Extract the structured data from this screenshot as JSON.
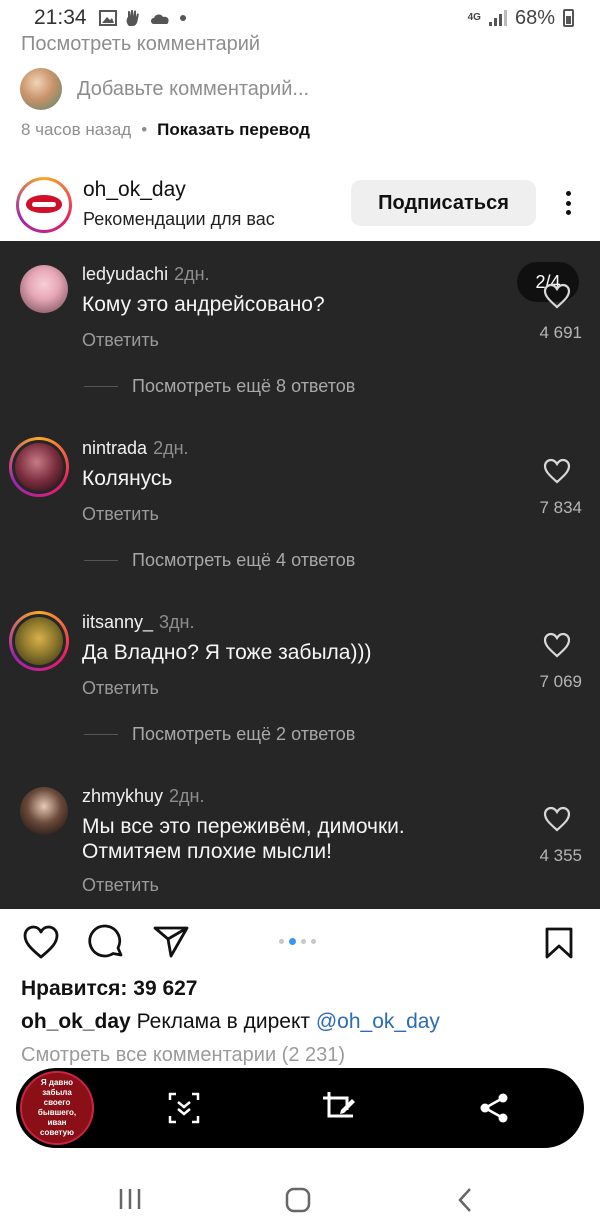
{
  "status_bar": {
    "time": "21:34",
    "network": "4G",
    "battery": "68%",
    "icons": [
      "image-icon",
      "hand-icon",
      "cloud-icon",
      "dot-icon"
    ]
  },
  "top": {
    "view_comment": "Посмотреть комментарий",
    "add_comment_placeholder": "Добавьте комментарий...",
    "time_ago": "8 часов назад",
    "separator": "•",
    "show_translation": "Показать перевод"
  },
  "post": {
    "username": "oh_ok_day",
    "subtitle": "Рекомендации для вас",
    "follow_label": "Подписаться"
  },
  "carousel": {
    "counter": "2/4",
    "comments": [
      {
        "username": "ledyudachi",
        "time": "2дн.",
        "text": "Кому это андрейсовано?",
        "reply": "Ответить",
        "likes": "4 691",
        "more": "Посмотреть ещё 8 ответов"
      },
      {
        "username": "nintrada",
        "time": "2дн.",
        "text": "Колянусь",
        "reply": "Ответить",
        "likes": "7 834",
        "more": "Посмотреть ещё 4 ответов"
      },
      {
        "username": "iitsanny_",
        "time": "3дн.",
        "text": "Да Владно? Я тоже забыла)))",
        "reply": "Ответить",
        "likes": "7 069",
        "more": "Посмотреть ещё 2 ответов"
      },
      {
        "username": "zhmykhuy",
        "time": "2дн.",
        "text": "Мы все это переживём, димочки. Отмитяем плохие мысли!",
        "reply": "Ответить",
        "likes": "4 355"
      }
    ]
  },
  "bottom": {
    "likes": "Нравится: 39 627",
    "caption_user": "oh_ok_day",
    "caption_text": "Реклама в директ",
    "caption_mention": "@oh_ok_day",
    "view_all_comments": "Смотреть все комментарии (2 231)"
  },
  "toolbar": {
    "thumb_text": "Я давно забыла своего бывшего, иван советую"
  },
  "colors": {
    "dark_panel": "#262626",
    "mention": "#2c6bb6",
    "dot_active": "#3897f0"
  }
}
